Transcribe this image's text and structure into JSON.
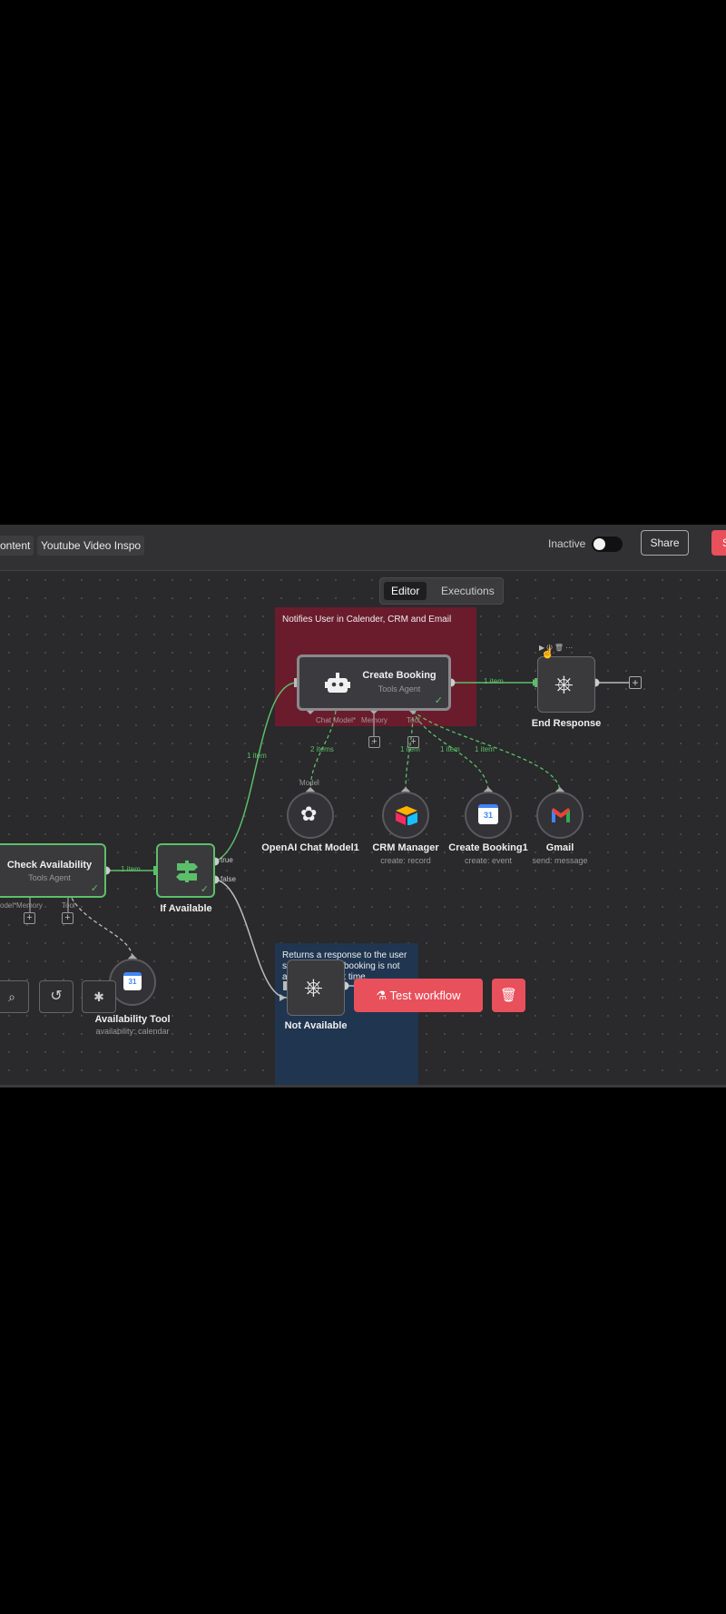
{
  "header": {
    "breadcrumbs": [
      "ontent",
      "Youtube Video Inspo"
    ],
    "status_label": "Inactive",
    "share_label": "Share",
    "save_label": "S"
  },
  "tabs": [
    {
      "label": "Editor",
      "active": true
    },
    {
      "label": "Executions",
      "active": false
    }
  ],
  "stickies": [
    {
      "text": "Notifies User in Calender, CRM and Email",
      "color": "#6b1c2c"
    },
    {
      "text": "Returns a response to the user saying that the booking is not available at that time.",
      "color": "#1f3550"
    }
  ],
  "nodes": {
    "check_availability": {
      "title": "Check Availability",
      "subtitle": "Tools Agent",
      "ports": [
        "odel*",
        "Memory",
        "Tool"
      ]
    },
    "if_available": {
      "title": "If Available",
      "true_label": "true",
      "false_label": "false"
    },
    "create_booking": {
      "title": "Create Booking",
      "subtitle": "Tools Agent",
      "ports": [
        "Chat Model*",
        "Memory",
        "Tool"
      ]
    },
    "end_response": {
      "title": "End Response"
    },
    "openai": {
      "title": "OpenAI Chat Model1",
      "port_label": "Model"
    },
    "crm": {
      "title": "CRM Manager",
      "subtitle": "create: record"
    },
    "create_booking1": {
      "title": "Create Booking1",
      "subtitle": "create: event"
    },
    "gmail": {
      "title": "Gmail",
      "subtitle": "send: message"
    },
    "availability_tool": {
      "title": "Availability Tool",
      "subtitle": "availability: calendar"
    },
    "not_available": {
      "title": "Not Available"
    }
  },
  "connections": {
    "check_to_if": "1 item",
    "if_to_booking": "1 item",
    "booking_to_end": "1 item",
    "model_items": "2 items",
    "crm_items": "1 item",
    "calendar_items": "1 item",
    "gmail_items": "1 item"
  },
  "actions": {
    "test_workflow": "Test workflow"
  },
  "colors": {
    "accent_red": "#e8505b",
    "success_green": "#5bbf6a",
    "canvas_bg": "#2a292b"
  }
}
